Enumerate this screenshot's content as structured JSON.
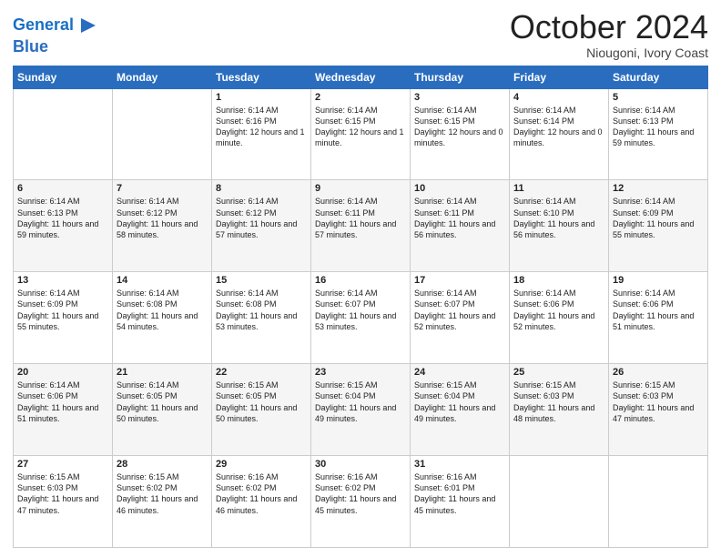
{
  "header": {
    "logo_line1": "General",
    "logo_line2": "Blue",
    "month": "October 2024",
    "location": "Niougoni, Ivory Coast"
  },
  "weekdays": [
    "Sunday",
    "Monday",
    "Tuesday",
    "Wednesday",
    "Thursday",
    "Friday",
    "Saturday"
  ],
  "weeks": [
    [
      {
        "day": "",
        "sunrise": "",
        "sunset": "",
        "daylight": ""
      },
      {
        "day": "",
        "sunrise": "",
        "sunset": "",
        "daylight": ""
      },
      {
        "day": "1",
        "sunrise": "Sunrise: 6:14 AM",
        "sunset": "Sunset: 6:16 PM",
        "daylight": "Daylight: 12 hours and 1 minute."
      },
      {
        "day": "2",
        "sunrise": "Sunrise: 6:14 AM",
        "sunset": "Sunset: 6:15 PM",
        "daylight": "Daylight: 12 hours and 1 minute."
      },
      {
        "day": "3",
        "sunrise": "Sunrise: 6:14 AM",
        "sunset": "Sunset: 6:15 PM",
        "daylight": "Daylight: 12 hours and 0 minutes."
      },
      {
        "day": "4",
        "sunrise": "Sunrise: 6:14 AM",
        "sunset": "Sunset: 6:14 PM",
        "daylight": "Daylight: 12 hours and 0 minutes."
      },
      {
        "day": "5",
        "sunrise": "Sunrise: 6:14 AM",
        "sunset": "Sunset: 6:13 PM",
        "daylight": "Daylight: 11 hours and 59 minutes."
      }
    ],
    [
      {
        "day": "6",
        "sunrise": "Sunrise: 6:14 AM",
        "sunset": "Sunset: 6:13 PM",
        "daylight": "Daylight: 11 hours and 59 minutes."
      },
      {
        "day": "7",
        "sunrise": "Sunrise: 6:14 AM",
        "sunset": "Sunset: 6:12 PM",
        "daylight": "Daylight: 11 hours and 58 minutes."
      },
      {
        "day": "8",
        "sunrise": "Sunrise: 6:14 AM",
        "sunset": "Sunset: 6:12 PM",
        "daylight": "Daylight: 11 hours and 57 minutes."
      },
      {
        "day": "9",
        "sunrise": "Sunrise: 6:14 AM",
        "sunset": "Sunset: 6:11 PM",
        "daylight": "Daylight: 11 hours and 57 minutes."
      },
      {
        "day": "10",
        "sunrise": "Sunrise: 6:14 AM",
        "sunset": "Sunset: 6:11 PM",
        "daylight": "Daylight: 11 hours and 56 minutes."
      },
      {
        "day": "11",
        "sunrise": "Sunrise: 6:14 AM",
        "sunset": "Sunset: 6:10 PM",
        "daylight": "Daylight: 11 hours and 56 minutes."
      },
      {
        "day": "12",
        "sunrise": "Sunrise: 6:14 AM",
        "sunset": "Sunset: 6:09 PM",
        "daylight": "Daylight: 11 hours and 55 minutes."
      }
    ],
    [
      {
        "day": "13",
        "sunrise": "Sunrise: 6:14 AM",
        "sunset": "Sunset: 6:09 PM",
        "daylight": "Daylight: 11 hours and 55 minutes."
      },
      {
        "day": "14",
        "sunrise": "Sunrise: 6:14 AM",
        "sunset": "Sunset: 6:08 PM",
        "daylight": "Daylight: 11 hours and 54 minutes."
      },
      {
        "day": "15",
        "sunrise": "Sunrise: 6:14 AM",
        "sunset": "Sunset: 6:08 PM",
        "daylight": "Daylight: 11 hours and 53 minutes."
      },
      {
        "day": "16",
        "sunrise": "Sunrise: 6:14 AM",
        "sunset": "Sunset: 6:07 PM",
        "daylight": "Daylight: 11 hours and 53 minutes."
      },
      {
        "day": "17",
        "sunrise": "Sunrise: 6:14 AM",
        "sunset": "Sunset: 6:07 PM",
        "daylight": "Daylight: 11 hours and 52 minutes."
      },
      {
        "day": "18",
        "sunrise": "Sunrise: 6:14 AM",
        "sunset": "Sunset: 6:06 PM",
        "daylight": "Daylight: 11 hours and 52 minutes."
      },
      {
        "day": "19",
        "sunrise": "Sunrise: 6:14 AM",
        "sunset": "Sunset: 6:06 PM",
        "daylight": "Daylight: 11 hours and 51 minutes."
      }
    ],
    [
      {
        "day": "20",
        "sunrise": "Sunrise: 6:14 AM",
        "sunset": "Sunset: 6:06 PM",
        "daylight": "Daylight: 11 hours and 51 minutes."
      },
      {
        "day": "21",
        "sunrise": "Sunrise: 6:14 AM",
        "sunset": "Sunset: 6:05 PM",
        "daylight": "Daylight: 11 hours and 50 minutes."
      },
      {
        "day": "22",
        "sunrise": "Sunrise: 6:15 AM",
        "sunset": "Sunset: 6:05 PM",
        "daylight": "Daylight: 11 hours and 50 minutes."
      },
      {
        "day": "23",
        "sunrise": "Sunrise: 6:15 AM",
        "sunset": "Sunset: 6:04 PM",
        "daylight": "Daylight: 11 hours and 49 minutes."
      },
      {
        "day": "24",
        "sunrise": "Sunrise: 6:15 AM",
        "sunset": "Sunset: 6:04 PM",
        "daylight": "Daylight: 11 hours and 49 minutes."
      },
      {
        "day": "25",
        "sunrise": "Sunrise: 6:15 AM",
        "sunset": "Sunset: 6:03 PM",
        "daylight": "Daylight: 11 hours and 48 minutes."
      },
      {
        "day": "26",
        "sunrise": "Sunrise: 6:15 AM",
        "sunset": "Sunset: 6:03 PM",
        "daylight": "Daylight: 11 hours and 47 minutes."
      }
    ],
    [
      {
        "day": "27",
        "sunrise": "Sunrise: 6:15 AM",
        "sunset": "Sunset: 6:03 PM",
        "daylight": "Daylight: 11 hours and 47 minutes."
      },
      {
        "day": "28",
        "sunrise": "Sunrise: 6:15 AM",
        "sunset": "Sunset: 6:02 PM",
        "daylight": "Daylight: 11 hours and 46 minutes."
      },
      {
        "day": "29",
        "sunrise": "Sunrise: 6:16 AM",
        "sunset": "Sunset: 6:02 PM",
        "daylight": "Daylight: 11 hours and 46 minutes."
      },
      {
        "day": "30",
        "sunrise": "Sunrise: 6:16 AM",
        "sunset": "Sunset: 6:02 PM",
        "daylight": "Daylight: 11 hours and 45 minutes."
      },
      {
        "day": "31",
        "sunrise": "Sunrise: 6:16 AM",
        "sunset": "Sunset: 6:01 PM",
        "daylight": "Daylight: 11 hours and 45 minutes."
      },
      {
        "day": "",
        "sunrise": "",
        "sunset": "",
        "daylight": ""
      },
      {
        "day": "",
        "sunrise": "",
        "sunset": "",
        "daylight": ""
      }
    ]
  ]
}
